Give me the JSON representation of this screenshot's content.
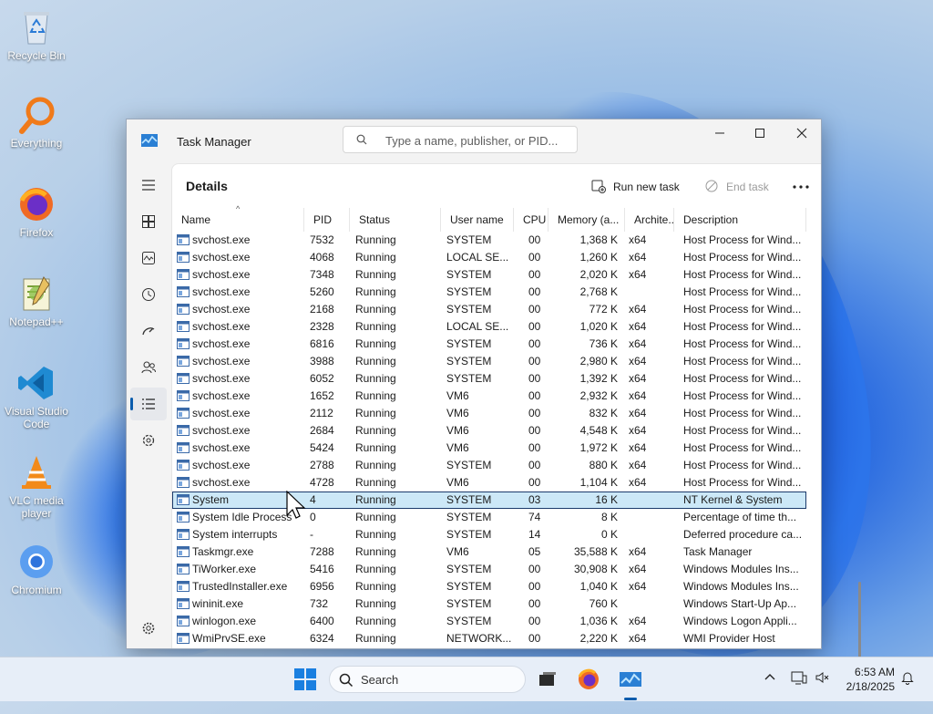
{
  "desktop": {
    "icons": [
      {
        "label": "Recycle Bin",
        "icon": "recycle-bin-icon"
      },
      {
        "label": "Everything",
        "icon": "everything-search-icon"
      },
      {
        "label": "Firefox",
        "icon": "firefox-icon"
      },
      {
        "label": "Notepad++",
        "icon": "notepad-plus-plus-icon"
      },
      {
        "label": "Visual Studio Code",
        "icon": "vscode-icon"
      },
      {
        "label": "VLC media player",
        "icon": "vlc-icon"
      },
      {
        "label": "Chromium",
        "icon": "chromium-icon"
      }
    ]
  },
  "window": {
    "title": "Task Manager",
    "search_placeholder": "Type a name, publisher, or PID...",
    "page_title": "Details",
    "run_new_task": "Run new task",
    "end_task": "End task",
    "nav": [
      "hamburger-icon",
      "processes-icon",
      "performance-icon",
      "app-history-icon",
      "startup-apps-icon",
      "users-icon",
      "details-icon",
      "services-icon",
      "settings-icon"
    ],
    "active_nav": "details-icon"
  },
  "table": {
    "columns": [
      "Name",
      "PID",
      "Status",
      "User name",
      "CPU",
      "Memory (a...",
      "Archite...",
      "Description"
    ],
    "sorted_column": "Name",
    "rows": [
      {
        "name": "svchost.exe",
        "pid": "7532",
        "status": "Running",
        "user": "SYSTEM",
        "cpu": "00",
        "mem": "1,368 K",
        "arch": "x64",
        "desc": "Host Process for Wind..."
      },
      {
        "name": "svchost.exe",
        "pid": "4068",
        "status": "Running",
        "user": "LOCAL SE...",
        "cpu": "00",
        "mem": "1,260 K",
        "arch": "x64",
        "desc": "Host Process for Wind..."
      },
      {
        "name": "svchost.exe",
        "pid": "7348",
        "status": "Running",
        "user": "SYSTEM",
        "cpu": "00",
        "mem": "2,020 K",
        "arch": "x64",
        "desc": "Host Process for Wind..."
      },
      {
        "name": "svchost.exe",
        "pid": "5260",
        "status": "Running",
        "user": "SYSTEM",
        "cpu": "00",
        "mem": "2,768 K",
        "arch": "",
        "desc": "Host Process for Wind..."
      },
      {
        "name": "svchost.exe",
        "pid": "2168",
        "status": "Running",
        "user": "SYSTEM",
        "cpu": "00",
        "mem": "772 K",
        "arch": "x64",
        "desc": "Host Process for Wind..."
      },
      {
        "name": "svchost.exe",
        "pid": "2328",
        "status": "Running",
        "user": "LOCAL SE...",
        "cpu": "00",
        "mem": "1,020 K",
        "arch": "x64",
        "desc": "Host Process for Wind..."
      },
      {
        "name": "svchost.exe",
        "pid": "6816",
        "status": "Running",
        "user": "SYSTEM",
        "cpu": "00",
        "mem": "736 K",
        "arch": "x64",
        "desc": "Host Process for Wind..."
      },
      {
        "name": "svchost.exe",
        "pid": "3988",
        "status": "Running",
        "user": "SYSTEM",
        "cpu": "00",
        "mem": "2,980 K",
        "arch": "x64",
        "desc": "Host Process for Wind..."
      },
      {
        "name": "svchost.exe",
        "pid": "6052",
        "status": "Running",
        "user": "SYSTEM",
        "cpu": "00",
        "mem": "1,392 K",
        "arch": "x64",
        "desc": "Host Process for Wind..."
      },
      {
        "name": "svchost.exe",
        "pid": "1652",
        "status": "Running",
        "user": "VM6",
        "cpu": "00",
        "mem": "2,932 K",
        "arch": "x64",
        "desc": "Host Process for Wind..."
      },
      {
        "name": "svchost.exe",
        "pid": "2112",
        "status": "Running",
        "user": "VM6",
        "cpu": "00",
        "mem": "832 K",
        "arch": "x64",
        "desc": "Host Process for Wind..."
      },
      {
        "name": "svchost.exe",
        "pid": "2684",
        "status": "Running",
        "user": "VM6",
        "cpu": "00",
        "mem": "4,548 K",
        "arch": "x64",
        "desc": "Host Process for Wind..."
      },
      {
        "name": "svchost.exe",
        "pid": "5424",
        "status": "Running",
        "user": "VM6",
        "cpu": "00",
        "mem": "1,972 K",
        "arch": "x64",
        "desc": "Host Process for Wind..."
      },
      {
        "name": "svchost.exe",
        "pid": "2788",
        "status": "Running",
        "user": "SYSTEM",
        "cpu": "00",
        "mem": "880 K",
        "arch": "x64",
        "desc": "Host Process for Wind..."
      },
      {
        "name": "svchost.exe",
        "pid": "4728",
        "status": "Running",
        "user": "VM6",
        "cpu": "00",
        "mem": "1,104 K",
        "arch": "x64",
        "desc": "Host Process for Wind..."
      },
      {
        "name": "System",
        "pid": "4",
        "status": "Running",
        "user": "SYSTEM",
        "cpu": "03",
        "mem": "16 K",
        "arch": "",
        "desc": "NT Kernel & System",
        "selected": true
      },
      {
        "name": "System Idle Process",
        "pid": "0",
        "status": "Running",
        "user": "SYSTEM",
        "cpu": "74",
        "mem": "8 K",
        "arch": "",
        "desc": "Percentage of time th..."
      },
      {
        "name": "System interrupts",
        "pid": "-",
        "status": "Running",
        "user": "SYSTEM",
        "cpu": "14",
        "mem": "0 K",
        "arch": "",
        "desc": "Deferred procedure ca..."
      },
      {
        "name": "Taskmgr.exe",
        "pid": "7288",
        "status": "Running",
        "user": "VM6",
        "cpu": "05",
        "mem": "35,588 K",
        "arch": "x64",
        "desc": "Task Manager"
      },
      {
        "name": "TiWorker.exe",
        "pid": "5416",
        "status": "Running",
        "user": "SYSTEM",
        "cpu": "00",
        "mem": "30,908 K",
        "arch": "x64",
        "desc": "Windows Modules Ins..."
      },
      {
        "name": "TrustedInstaller.exe",
        "pid": "6956",
        "status": "Running",
        "user": "SYSTEM",
        "cpu": "00",
        "mem": "1,040 K",
        "arch": "x64",
        "desc": "Windows Modules Ins..."
      },
      {
        "name": "wininit.exe",
        "pid": "732",
        "status": "Running",
        "user": "SYSTEM",
        "cpu": "00",
        "mem": "760 K",
        "arch": "",
        "desc": "Windows Start-Up Ap..."
      },
      {
        "name": "winlogon.exe",
        "pid": "6400",
        "status": "Running",
        "user": "SYSTEM",
        "cpu": "00",
        "mem": "1,036 K",
        "arch": "x64",
        "desc": "Windows Logon Appli..."
      },
      {
        "name": "WmiPrvSE.exe",
        "pid": "6324",
        "status": "Running",
        "user": "NETWORK...",
        "cpu": "00",
        "mem": "2,220 K",
        "arch": "x64",
        "desc": "WMI Provider Host"
      }
    ]
  },
  "taskbar": {
    "search_placeholder": "Search",
    "time": "6:53 AM",
    "date": "2/18/2025",
    "apps": [
      "start-icon",
      "task-view-icon",
      "firefox-icon",
      "task-manager-icon"
    ]
  },
  "colors": {
    "accent": "#0b5cad",
    "selection": "#cce8f7"
  }
}
